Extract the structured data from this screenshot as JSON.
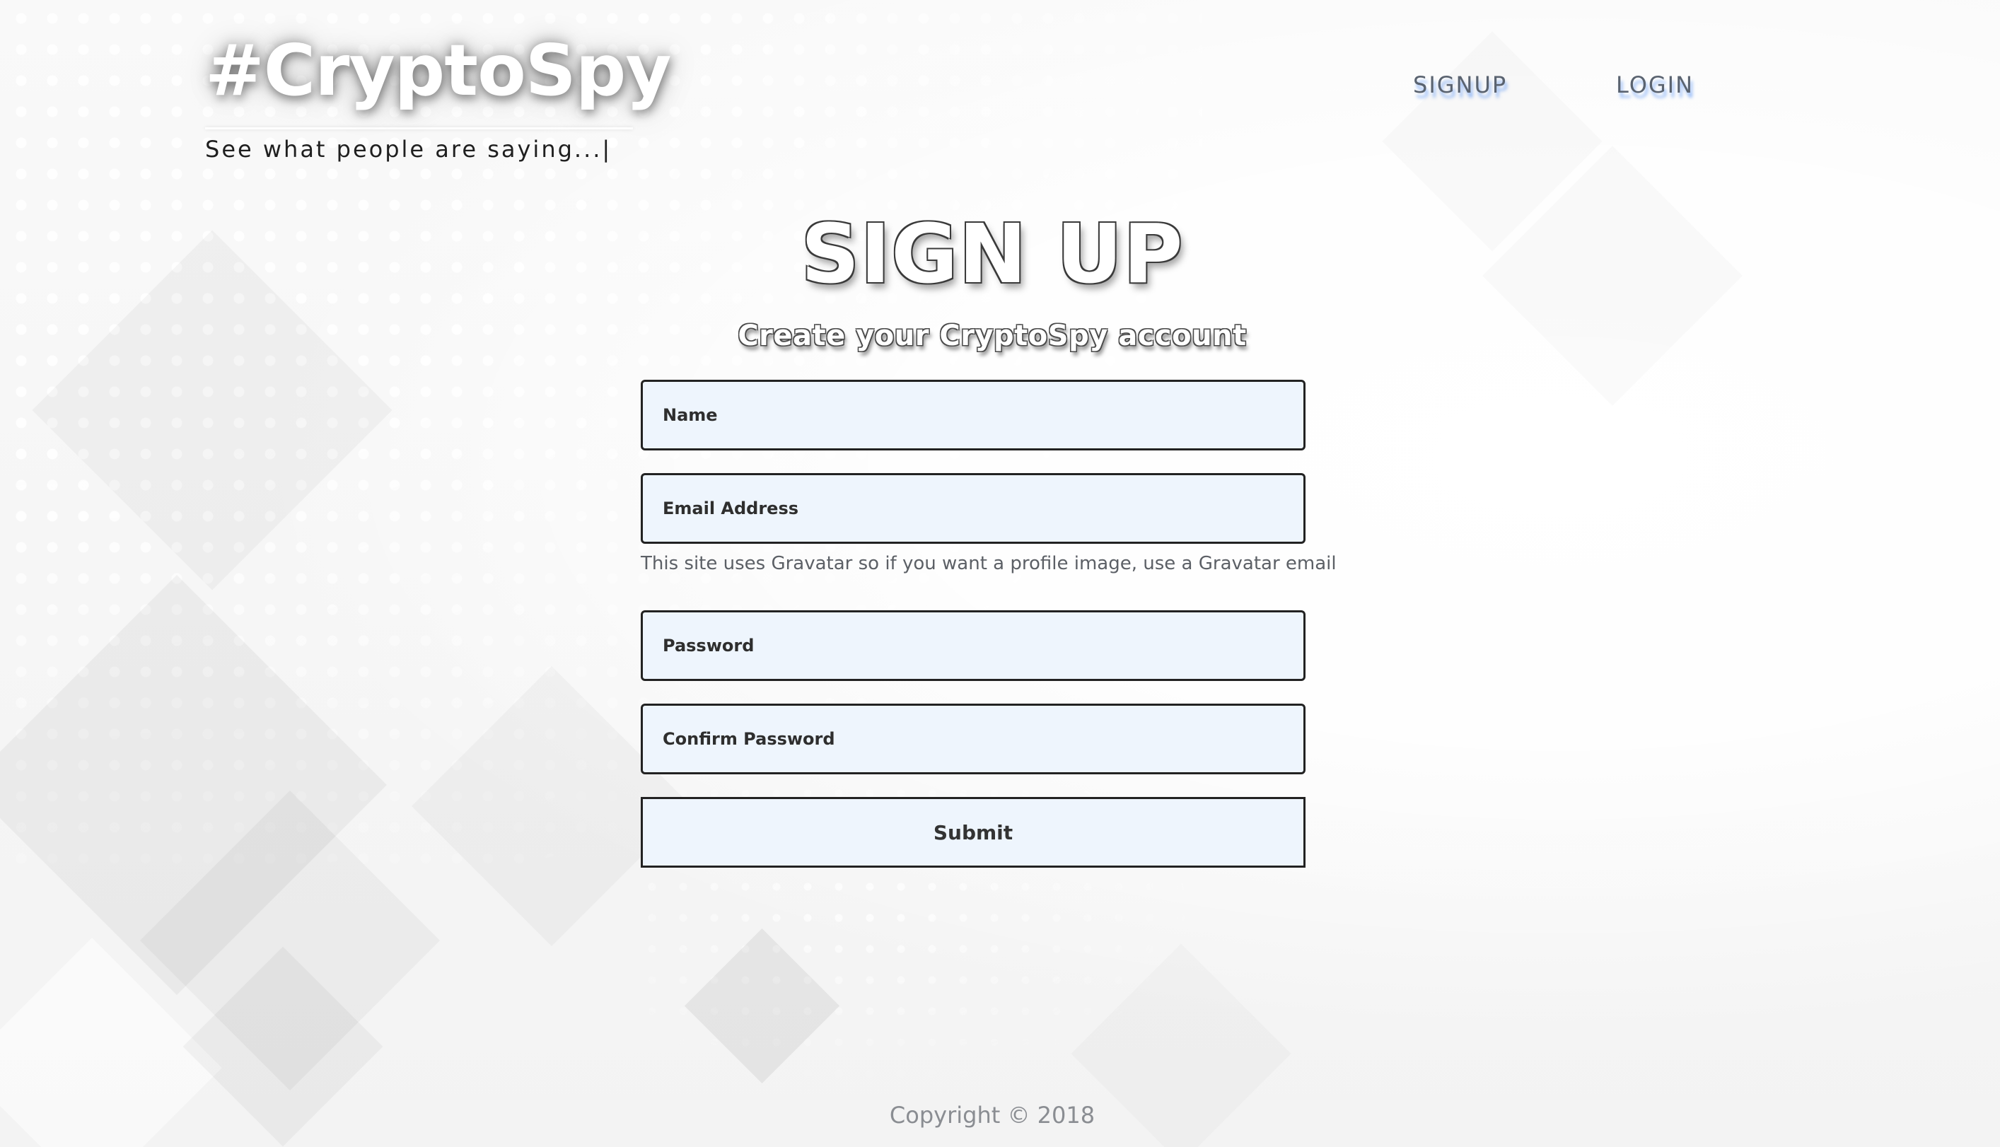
{
  "brand": {
    "title": "#CryptoSpy",
    "tagline": "See what people are saying...|"
  },
  "nav": {
    "items": [
      {
        "label": "SIGNUP"
      },
      {
        "label": "LOGIN"
      }
    ]
  },
  "page": {
    "title": "SIGN UP",
    "subtitle": "Create your CryptoSpy account"
  },
  "form": {
    "name": {
      "placeholder": "Name",
      "value": ""
    },
    "email": {
      "placeholder": "Email Address",
      "value": ""
    },
    "gravatar_hint": "This site uses Gravatar so if you want a profile image, use a Gravatar email",
    "password": {
      "placeholder": "Password",
      "value": ""
    },
    "confirm_password": {
      "placeholder": "Confirm Password",
      "value": ""
    },
    "submit_label": "Submit"
  },
  "footer": {
    "copyright": "Copyright © 2018"
  },
  "colors": {
    "background": "#f7f7f7",
    "field_background": "#eef5fd",
    "field_border": "#222222",
    "nav_text": "#5a6370",
    "nav_shadow": "#4285f4",
    "hint_text": "#5c6066",
    "footer_text": "#8a8d92"
  }
}
